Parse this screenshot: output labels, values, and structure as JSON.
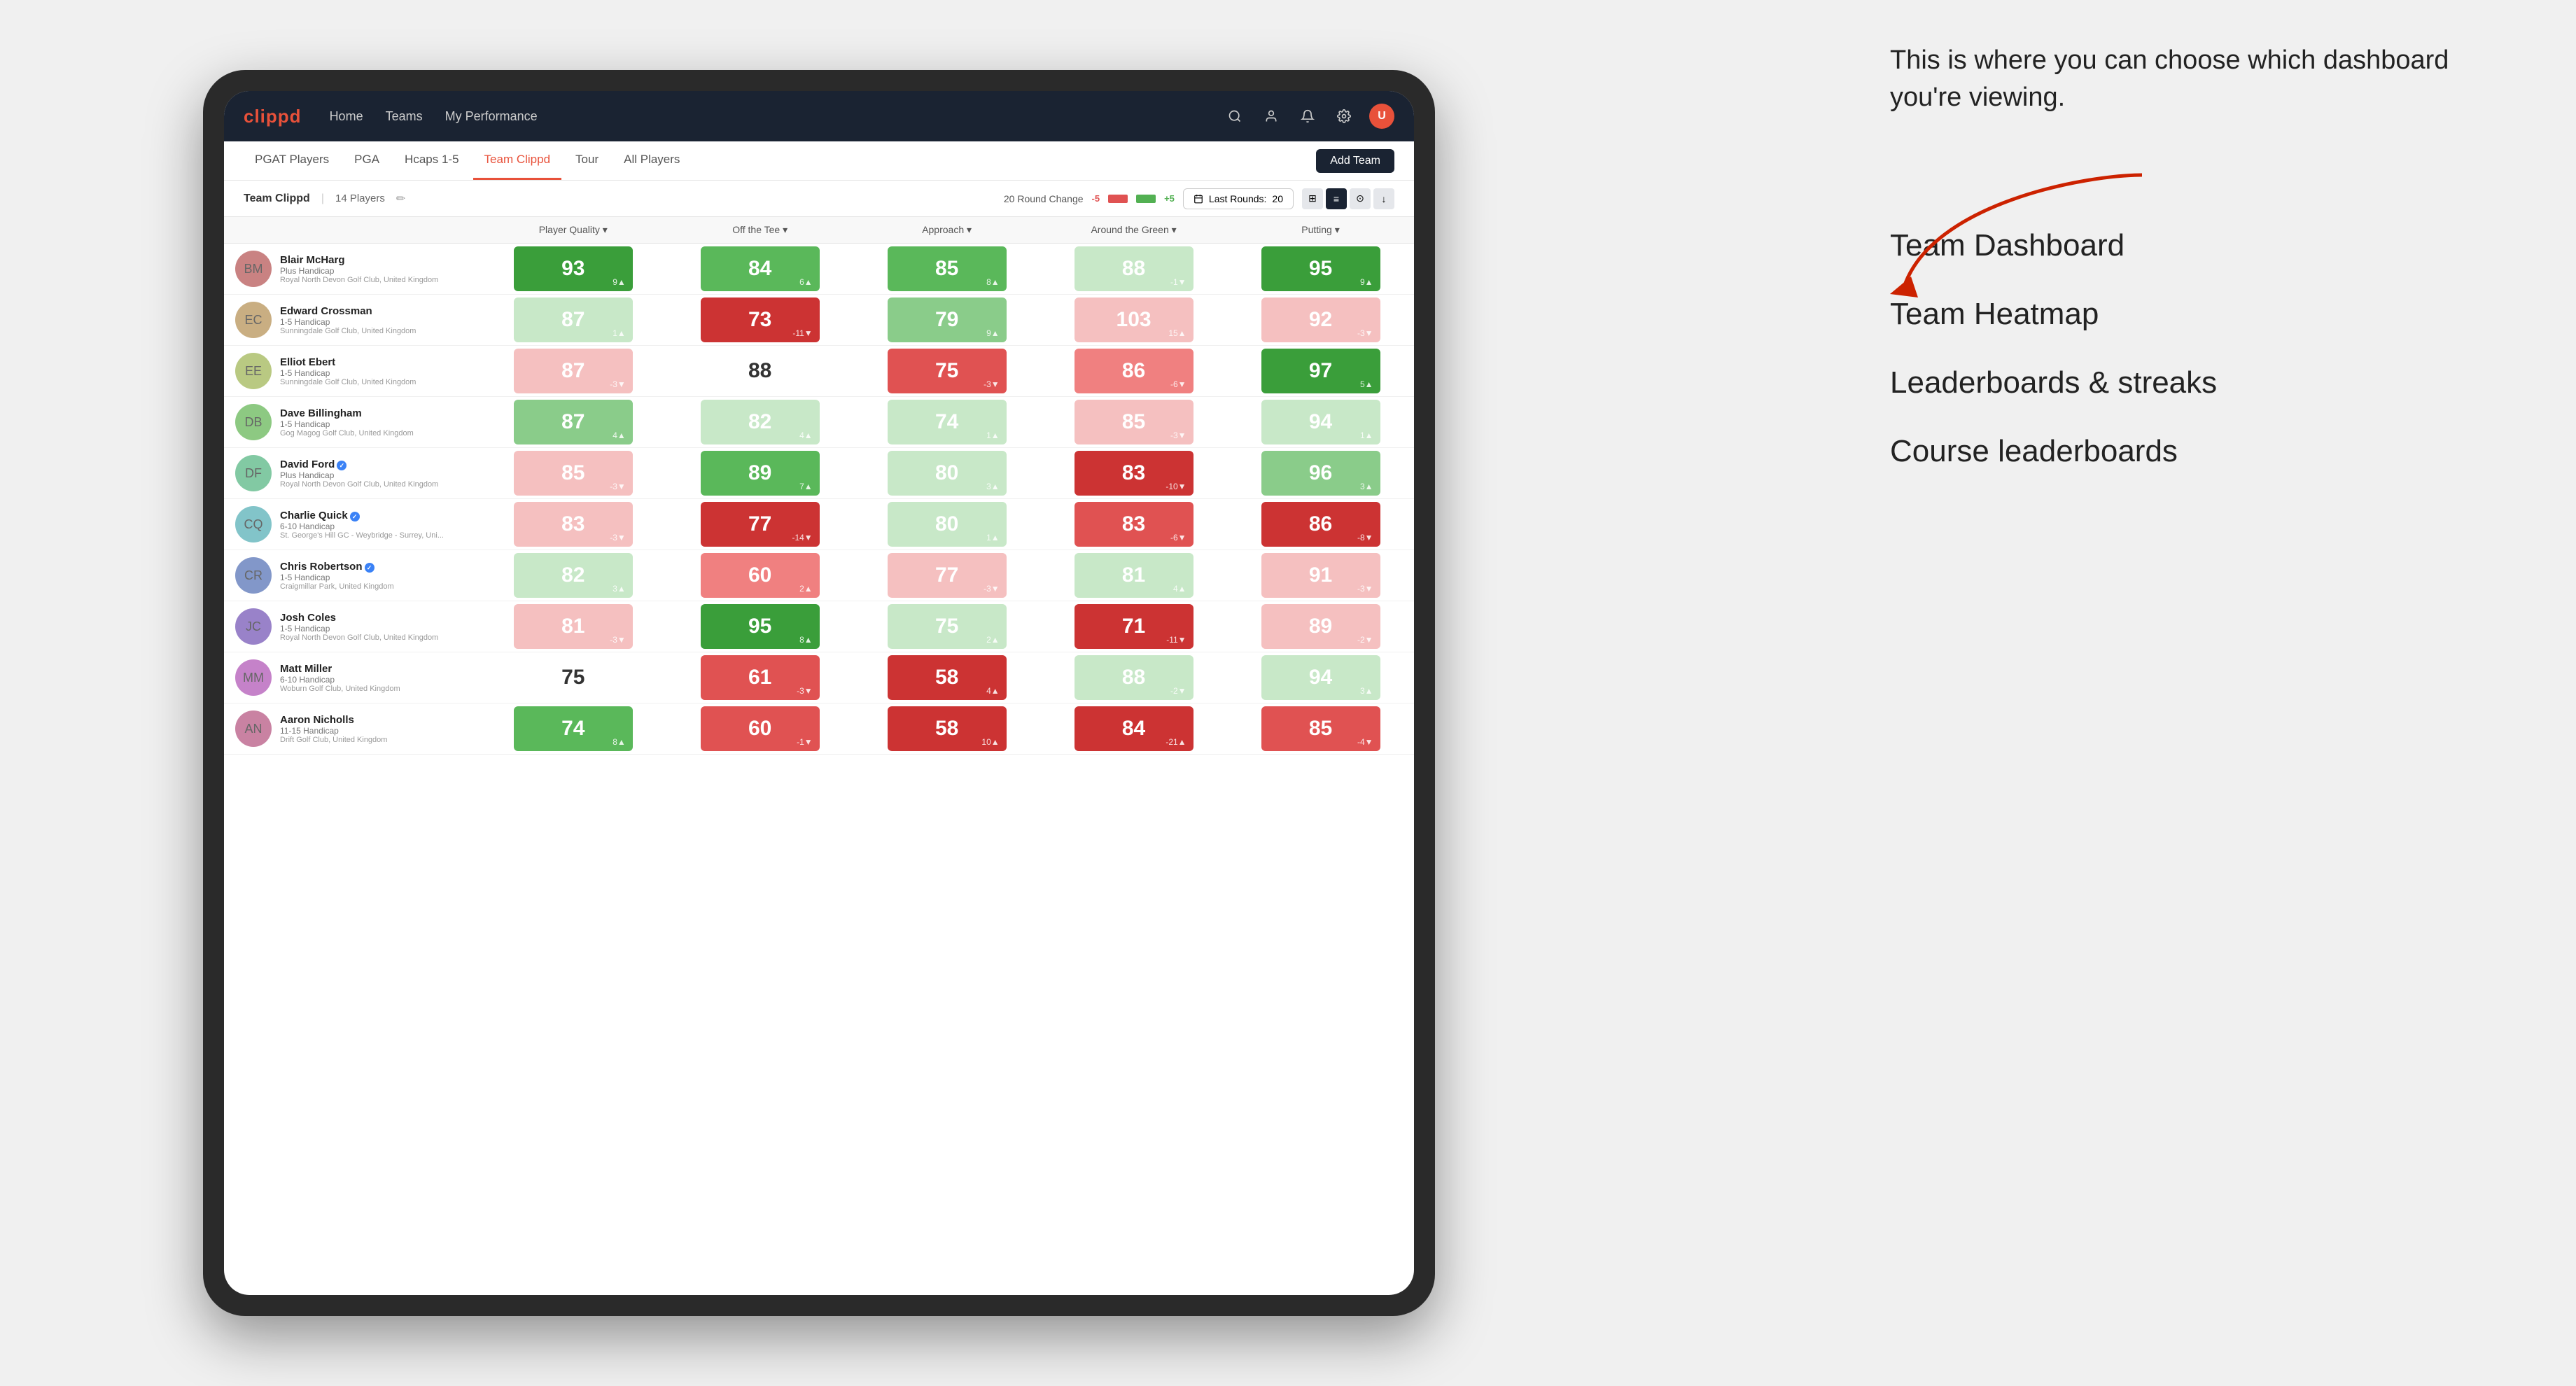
{
  "annotation": {
    "intro": "This is where you can choose which dashboard you're viewing.",
    "options": [
      "Team Dashboard",
      "Team Heatmap",
      "Leaderboards & streaks",
      "Course leaderboards"
    ]
  },
  "nav": {
    "logo": "clippd",
    "links": [
      "Home",
      "Teams",
      "My Performance"
    ],
    "icons": [
      "search",
      "person",
      "bell",
      "settings",
      "avatar"
    ]
  },
  "sub_nav": {
    "links": [
      "PGAT Players",
      "PGA",
      "Hcaps 1-5",
      "Team Clippd",
      "Tour",
      "All Players"
    ],
    "active": "Team Clippd",
    "add_button": "Add Team"
  },
  "team_bar": {
    "name": "Team Clippd",
    "separator": "|",
    "count": "14 Players",
    "round_change_label": "20 Round Change",
    "minus": "-5",
    "plus": "+5",
    "last_rounds_label": "Last Rounds:",
    "last_rounds_value": "20"
  },
  "table": {
    "headers": [
      "Player Quality ▾",
      "Off the Tee ▾",
      "Approach ▾",
      "Around the Green ▾",
      "Putting ▾"
    ],
    "players": [
      {
        "name": "Blair McHarg",
        "hcap": "Plus Handicap",
        "club": "Royal North Devon Golf Club, United Kingdom",
        "stats": [
          {
            "value": "93",
            "change": "9▲",
            "color": "green-dark"
          },
          {
            "value": "84",
            "change": "6▲",
            "color": "green-mid"
          },
          {
            "value": "85",
            "change": "8▲",
            "color": "green-mid"
          },
          {
            "value": "88",
            "change": "-1▼",
            "color": "green-pale"
          },
          {
            "value": "95",
            "change": "9▲",
            "color": "green-dark"
          }
        ]
      },
      {
        "name": "Edward Crossman",
        "hcap": "1-5 Handicap",
        "club": "Sunningdale Golf Club, United Kingdom",
        "stats": [
          {
            "value": "87",
            "change": "1▲",
            "color": "green-pale"
          },
          {
            "value": "73",
            "change": "-11▼",
            "color": "red-dark"
          },
          {
            "value": "79",
            "change": "9▲",
            "color": "green-light"
          },
          {
            "value": "103",
            "change": "15▲",
            "color": "red-pale"
          },
          {
            "value": "92",
            "change": "-3▼",
            "color": "red-pale"
          }
        ]
      },
      {
        "name": "Elliot Ebert",
        "hcap": "1-5 Handicap",
        "club": "Sunningdale Golf Club, United Kingdom",
        "stats": [
          {
            "value": "87",
            "change": "-3▼",
            "color": "red-pale"
          },
          {
            "value": "88",
            "change": "",
            "color": "white"
          },
          {
            "value": "75",
            "change": "-3▼",
            "color": "red-mid"
          },
          {
            "value": "86",
            "change": "-6▼",
            "color": "red-light"
          },
          {
            "value": "97",
            "change": "5▲",
            "color": "green-dark"
          }
        ]
      },
      {
        "name": "Dave Billingham",
        "hcap": "1-5 Handicap",
        "club": "Gog Magog Golf Club, United Kingdom",
        "stats": [
          {
            "value": "87",
            "change": "4▲",
            "color": "green-light"
          },
          {
            "value": "82",
            "change": "4▲",
            "color": "green-pale"
          },
          {
            "value": "74",
            "change": "1▲",
            "color": "green-pale"
          },
          {
            "value": "85",
            "change": "-3▼",
            "color": "red-pale"
          },
          {
            "value": "94",
            "change": "1▲",
            "color": "green-pale"
          }
        ]
      },
      {
        "name": "David Ford",
        "hcap": "Plus Handicap",
        "club": "Royal North Devon Golf Club, United Kingdom",
        "verified": true,
        "stats": [
          {
            "value": "85",
            "change": "-3▼",
            "color": "red-pale"
          },
          {
            "value": "89",
            "change": "7▲",
            "color": "green-mid"
          },
          {
            "value": "80",
            "change": "3▲",
            "color": "green-pale"
          },
          {
            "value": "83",
            "change": "-10▼",
            "color": "red-dark"
          },
          {
            "value": "96",
            "change": "3▲",
            "color": "green-light"
          }
        ]
      },
      {
        "name": "Charlie Quick",
        "hcap": "6-10 Handicap",
        "club": "St. George's Hill GC - Weybridge - Surrey, Uni...",
        "verified": true,
        "stats": [
          {
            "value": "83",
            "change": "-3▼",
            "color": "red-pale"
          },
          {
            "value": "77",
            "change": "-14▼",
            "color": "red-dark"
          },
          {
            "value": "80",
            "change": "1▲",
            "color": "green-pale"
          },
          {
            "value": "83",
            "change": "-6▼",
            "color": "red-mid"
          },
          {
            "value": "86",
            "change": "-8▼",
            "color": "red-dark"
          }
        ]
      },
      {
        "name": "Chris Robertson",
        "hcap": "1-5 Handicap",
        "club": "Craigmillar Park, United Kingdom",
        "verified": true,
        "stats": [
          {
            "value": "82",
            "change": "3▲",
            "color": "green-pale"
          },
          {
            "value": "60",
            "change": "2▲",
            "color": "red-light"
          },
          {
            "value": "77",
            "change": "-3▼",
            "color": "red-pale"
          },
          {
            "value": "81",
            "change": "4▲",
            "color": "green-pale"
          },
          {
            "value": "91",
            "change": "-3▼",
            "color": "red-pale"
          }
        ]
      },
      {
        "name": "Josh Coles",
        "hcap": "1-5 Handicap",
        "club": "Royal North Devon Golf Club, United Kingdom",
        "stats": [
          {
            "value": "81",
            "change": "-3▼",
            "color": "red-pale"
          },
          {
            "value": "95",
            "change": "8▲",
            "color": "green-dark"
          },
          {
            "value": "75",
            "change": "2▲",
            "color": "green-pale"
          },
          {
            "value": "71",
            "change": "-11▼",
            "color": "red-dark"
          },
          {
            "value": "89",
            "change": "-2▼",
            "color": "red-pale"
          }
        ]
      },
      {
        "name": "Matt Miller",
        "hcap": "6-10 Handicap",
        "club": "Woburn Golf Club, United Kingdom",
        "stats": [
          {
            "value": "75",
            "change": "",
            "color": "white"
          },
          {
            "value": "61",
            "change": "-3▼",
            "color": "red-mid"
          },
          {
            "value": "58",
            "change": "4▲",
            "color": "red-dark"
          },
          {
            "value": "88",
            "change": "-2▼",
            "color": "green-pale"
          },
          {
            "value": "94",
            "change": "3▲",
            "color": "green-pale"
          }
        ]
      },
      {
        "name": "Aaron Nicholls",
        "hcap": "11-15 Handicap",
        "club": "Drift Golf Club, United Kingdom",
        "stats": [
          {
            "value": "74",
            "change": "8▲",
            "color": "green-mid"
          },
          {
            "value": "60",
            "change": "-1▼",
            "color": "red-mid"
          },
          {
            "value": "58",
            "change": "10▲",
            "color": "red-dark"
          },
          {
            "value": "84",
            "change": "-21▲",
            "color": "red-dark"
          },
          {
            "value": "85",
            "change": "-4▼",
            "color": "red-mid"
          }
        ]
      }
    ]
  },
  "colors": {
    "green_dark": "#3a9e3a",
    "green_mid": "#5ab85a",
    "green_light": "#8acc8a",
    "green_pale": "#b8e0b8",
    "red_dark": "#cc3333",
    "red_mid": "#e05252",
    "red_light": "#f08080",
    "red_pale": "#f5c0c0",
    "nav_bg": "#1a2332",
    "accent": "#e8513a"
  }
}
